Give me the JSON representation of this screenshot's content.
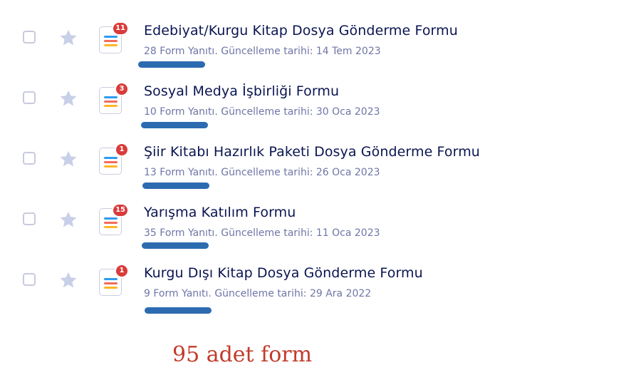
{
  "forms": [
    {
      "title": "Edebiyat/Kurgu Kitap Dosya Gönderme Formu",
      "meta": "28 Form Yanıtı. Güncelleme tarihi: 14 Tem 2023",
      "badge": "11"
    },
    {
      "title": "Sosyal Medya İşbirliği Formu",
      "meta": "10 Form Yanıtı. Güncelleme tarihi: 30 Oca 2023",
      "badge": "3"
    },
    {
      "title": "Şiir Kitabı Hazırlık Paketi Dosya Gönderme Formu",
      "meta": "13 Form Yanıtı. Güncelleme tarihi: 26 Oca 2023",
      "badge": "1"
    },
    {
      "title": "Yarışma Katılım Formu",
      "meta": "35 Form Yanıtı. Güncelleme tarihi: 11 Oca 2023",
      "badge": "15"
    },
    {
      "title": "Kurgu Dışı Kitap Dosya Gönderme Formu",
      "meta": "9 Form Yanıtı. Güncelleme tarihi: 29 Ara 2022",
      "badge": "1"
    }
  ],
  "annotation": {
    "total_text": "95 adet form"
  },
  "colors": {
    "title": "#0a1551",
    "meta": "#6f76a7",
    "badge": "#d93b3b",
    "star": "#c8cfe8",
    "highlight": "#2c6bb0",
    "annotation": "#c23b2b"
  },
  "icons": {
    "star": "star-icon",
    "form": "form-icon"
  }
}
